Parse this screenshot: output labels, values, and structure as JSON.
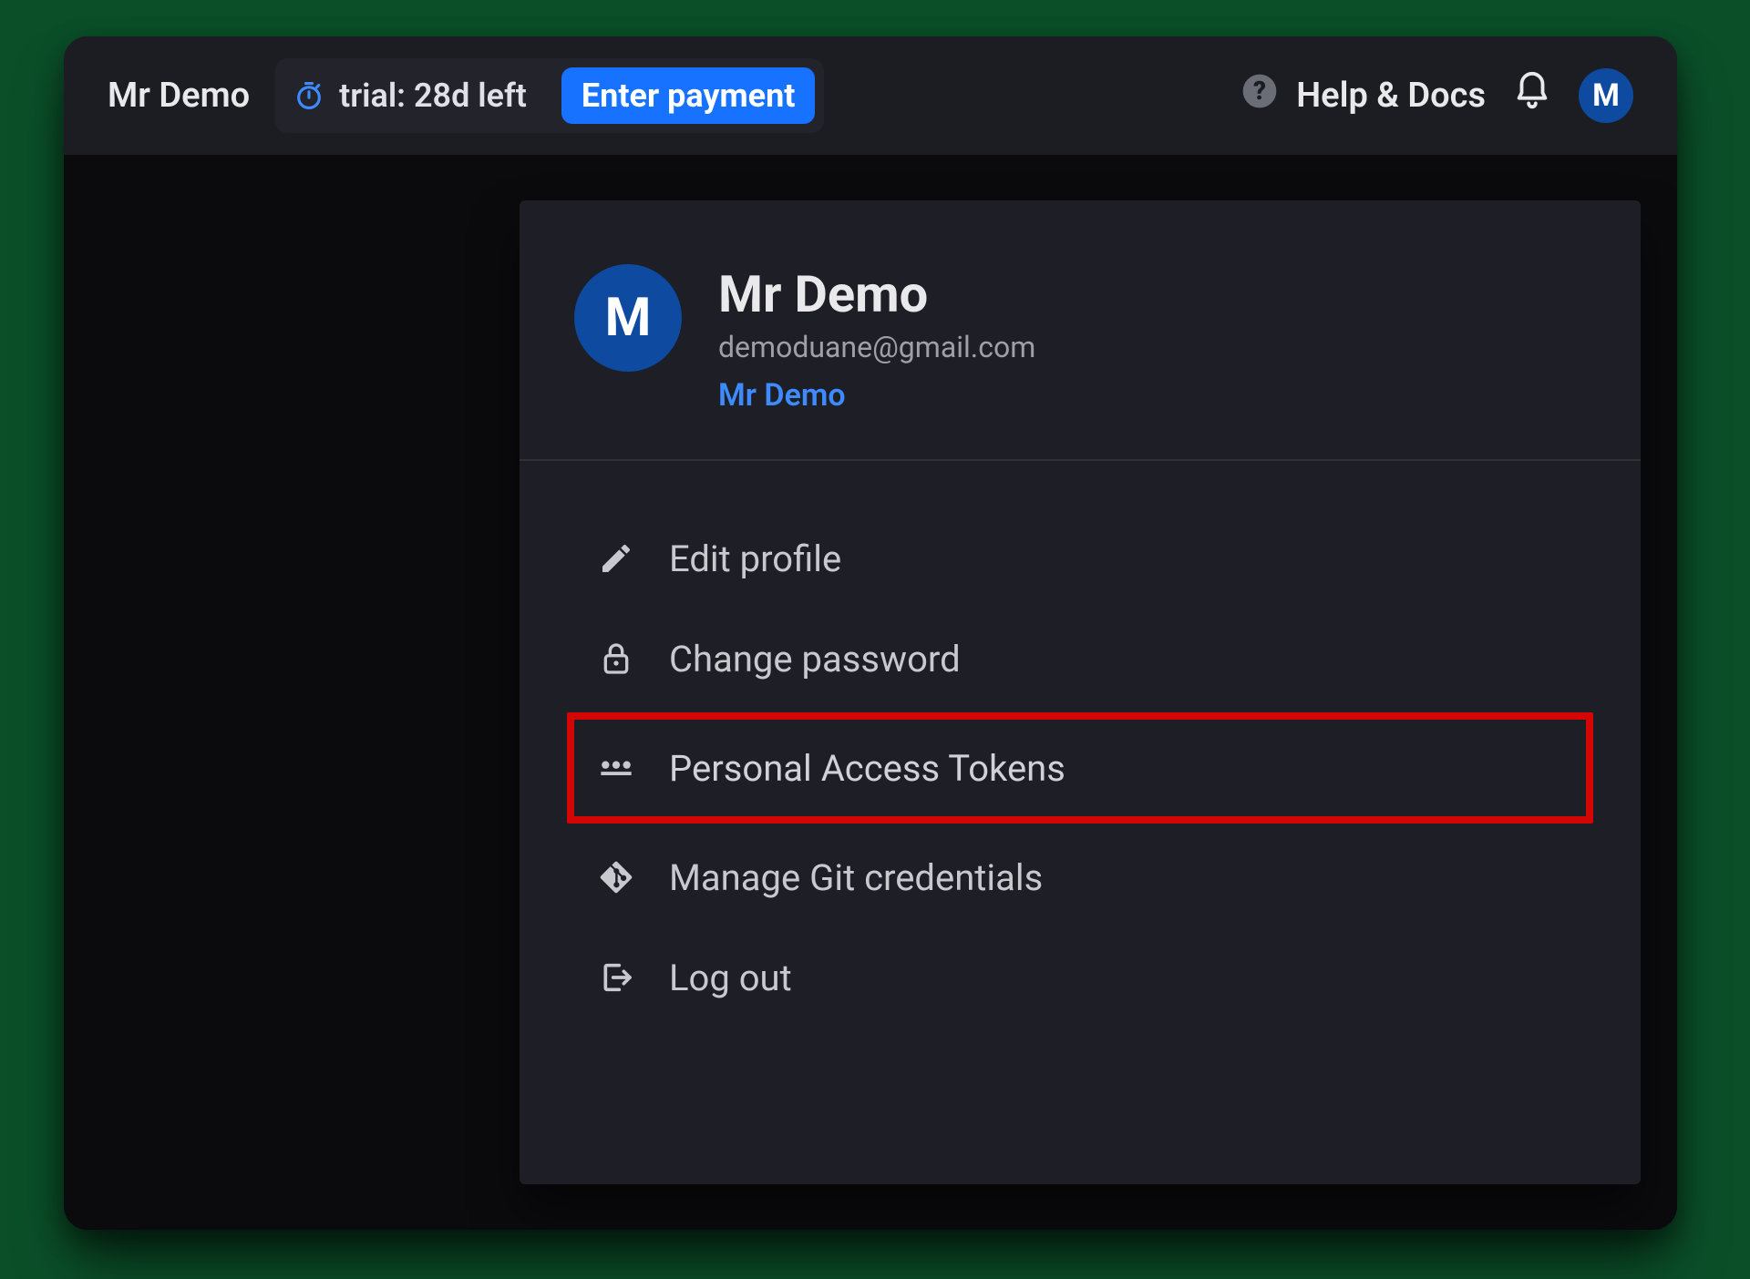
{
  "header": {
    "title": "Mr Demo",
    "trial_text": "trial: 28d left",
    "payment_button": "Enter payment",
    "help_label": "Help & Docs",
    "avatar_initial": "M"
  },
  "profile": {
    "avatar_initial": "M",
    "name": "Mr Demo",
    "email": "demoduane@gmail.com",
    "workspace_link": "Mr Demo"
  },
  "menu": [
    {
      "icon": "pencil-icon",
      "label": "Edit profile"
    },
    {
      "icon": "lock-icon",
      "label": "Change password"
    },
    {
      "icon": "password-dots-icon",
      "label": "Personal Access Tokens",
      "highlighted": true
    },
    {
      "icon": "git-icon",
      "label": "Manage Git credentials"
    },
    {
      "icon": "logout-icon",
      "label": "Log out"
    }
  ]
}
